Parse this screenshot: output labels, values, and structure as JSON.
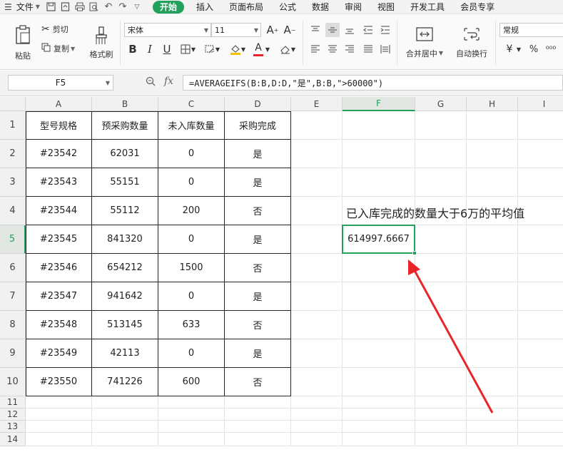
{
  "menu": {
    "file_label": "文件",
    "tabs": [
      "开始",
      "插入",
      "页面布局",
      "公式",
      "数据",
      "审阅",
      "视图",
      "开发工具",
      "会员专享"
    ],
    "active_tab": "开始"
  },
  "ribbon": {
    "paste_label": "粘贴",
    "cut_label": "剪切",
    "copy_label": "复制",
    "format_painter_label": "格式刷",
    "font_name": "宋体",
    "font_size": "11",
    "bold": "B",
    "italic": "I",
    "underline": "U",
    "font_color_glyph": "A",
    "merge_center_label": "合并居中",
    "wrap_label": "自动换行",
    "number_format": "常规",
    "currency_glyph": "¥",
    "percent_glyph": "%",
    "thousands_glyph": "⁰⁰⁰"
  },
  "formula_bar": {
    "cell_ref": "F5",
    "fx_label": "fx",
    "formula": "=AVERAGEIFS(B:B,D:D,\"是\",B:B,\">60000\")"
  },
  "sheet": {
    "columns": [
      "A",
      "B",
      "C",
      "D",
      "E",
      "F",
      "G",
      "H",
      "I"
    ],
    "rows": [
      "1",
      "2",
      "3",
      "4",
      "5",
      "6",
      "7",
      "8",
      "9",
      "10",
      "11",
      "12",
      "13",
      "14"
    ],
    "active_column": "F",
    "active_row": "5",
    "table_header": [
      "型号规格",
      "预采购数量",
      "未入库数量",
      "采购完成"
    ],
    "table_rows": [
      [
        "#23542",
        "62031",
        "0",
        "是"
      ],
      [
        "#23543",
        "55151",
        "0",
        "是"
      ],
      [
        "#23544",
        "55112",
        "200",
        "否"
      ],
      [
        "#23545",
        "841320",
        "0",
        "是"
      ],
      [
        "#23546",
        "654212",
        "1500",
        "否"
      ],
      [
        "#23547",
        "941642",
        "0",
        "是"
      ],
      [
        "#23548",
        "513145",
        "633",
        "否"
      ],
      [
        "#23549",
        "42113",
        "0",
        "是"
      ],
      [
        "#23550",
        "741226",
        "600",
        "否"
      ]
    ],
    "annotation": "已入库完成的数量大于6万的平均值",
    "result_value": "614997.6667"
  },
  "colors": {
    "accent": "#23a05c",
    "arrow": "#e8262a"
  },
  "icons": {
    "hamburger": "☰",
    "paste": "clipboard-icon",
    "cut": "scissors-icon",
    "copy": "copy-icon",
    "format_painter": "brush-icon",
    "zoom": "magnifier-icon"
  }
}
